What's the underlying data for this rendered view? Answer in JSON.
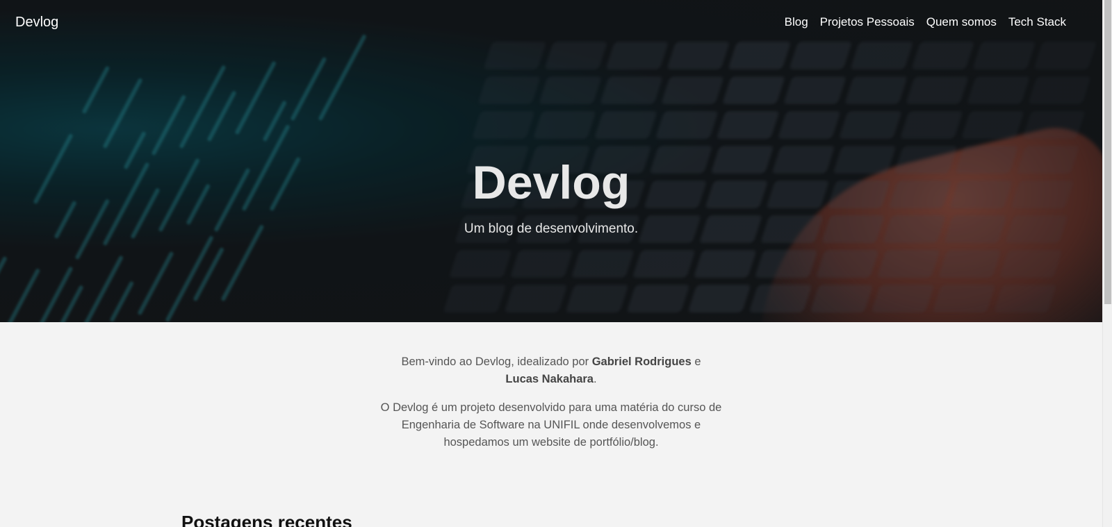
{
  "navbar": {
    "brand": "Devlog",
    "links": [
      "Blog",
      "Projetos Pessoais",
      "Quem somos",
      "Tech Stack"
    ]
  },
  "hero": {
    "title": "Devlog",
    "subtitle": "Um blog de desenvolvimento."
  },
  "intro": {
    "p1_before": "Bem-vindo ao Devlog, idealizado por ",
    "author1": "Gabriel Rodrigues",
    "p1_middle": " e ",
    "author2": "Lucas Nakahara",
    "p1_after": ".",
    "p2": "O Devlog é um projeto desenvolvido para uma matéria do curso de Engenharia de Software na UNIFIL onde desenvolvemos e hospedamos um website de portfólio/blog."
  },
  "recent": {
    "heading": "Postagens recentes"
  },
  "colors": {
    "page_background": "#f3f3f3",
    "hero_dark": "#17191b",
    "hero_teal": "#0d4a55",
    "nav_text": "#ffffff",
    "body_text": "#555555"
  }
}
